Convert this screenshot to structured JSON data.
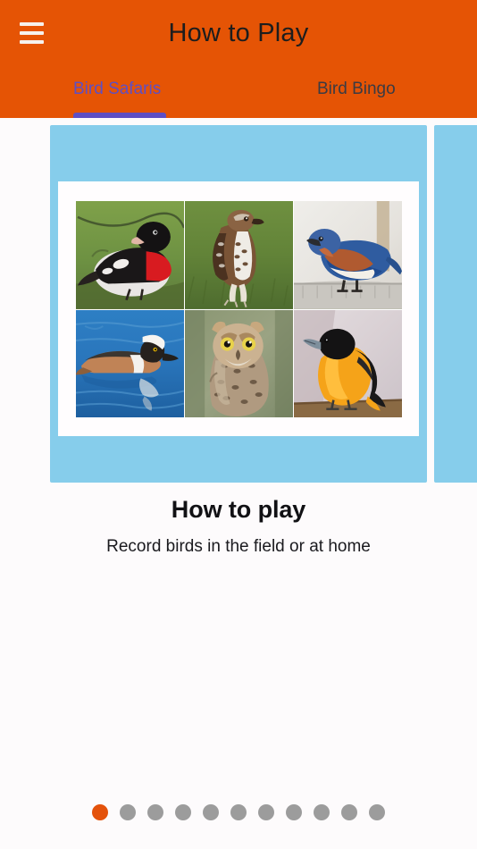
{
  "appbar": {
    "title": "How to Play",
    "menu_icon": "hamburger-menu-icon",
    "background_color": "#e55405",
    "title_color": "#1d1d1d"
  },
  "tabs": {
    "active_index": 0,
    "active_color": "#5e4fc4",
    "inactive_color": "#3b3b43",
    "items": [
      {
        "label": "Bird Safaris"
      },
      {
        "label": "Bird Bingo"
      }
    ]
  },
  "carousel": {
    "slide_background_color": "#86cdeb",
    "card_background_color": "#fffdfe",
    "current_slide": {
      "image_grid": {
        "rows": 2,
        "columns": 3,
        "cells": [
          {
            "name": "rose-breasted-grosbeak-photo"
          },
          {
            "name": "red-tailed-hawk-photo"
          },
          {
            "name": "eastern-bluebird-photo"
          },
          {
            "name": "hooded-merganser-photo"
          },
          {
            "name": "great-horned-owl-photo"
          },
          {
            "name": "baltimore-oriole-photo"
          }
        ]
      }
    },
    "caption": {
      "title": "How to play",
      "subtitle": "Record birds in the field or at home"
    }
  },
  "pagination": {
    "total": 11,
    "active_index": 0,
    "active_color": "#e4520b",
    "inactive_color": "#9c9c9c",
    "dots": [
      {
        "index": 1
      },
      {
        "index": 2
      },
      {
        "index": 3
      },
      {
        "index": 4
      },
      {
        "index": 5
      },
      {
        "index": 6
      },
      {
        "index": 7
      },
      {
        "index": 8
      },
      {
        "index": 9
      },
      {
        "index": 10
      },
      {
        "index": 11
      }
    ]
  }
}
